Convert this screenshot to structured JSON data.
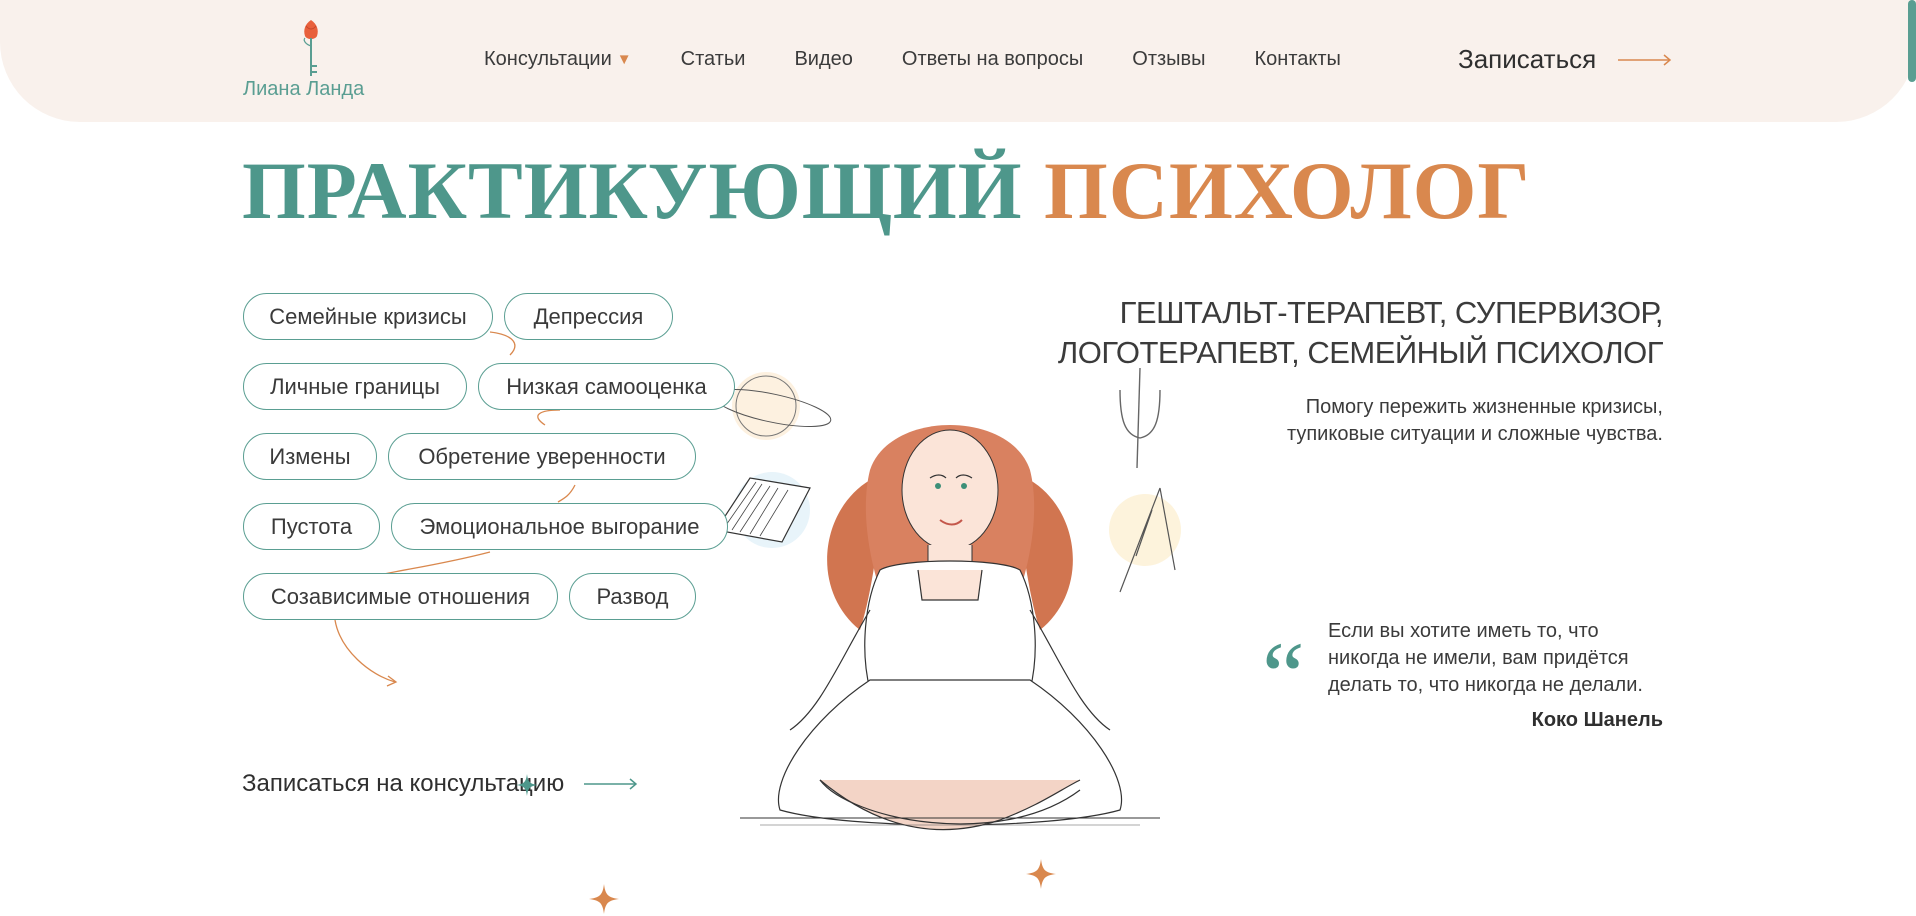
{
  "header": {
    "logo_text": "Лиана Ланда",
    "nav": [
      {
        "label": "Консультации",
        "has_dropdown": true
      },
      {
        "label": "Статьи"
      },
      {
        "label": "Видео"
      },
      {
        "label": "Ответы на вопросы"
      },
      {
        "label": "Отзывы"
      },
      {
        "label": "Контакты"
      }
    ],
    "signup_label": "Записаться"
  },
  "hero": {
    "title_part1": "ПРАКТИКУЮЩИЙ",
    "title_part2": "ПСИХОЛОГ",
    "tags": [
      "Семейные кризисы",
      "Депрессия",
      "Личные границы",
      "Низкая самооценка",
      "Измены",
      "Обретение уверенности",
      "Пустота",
      "Эмоциональное выгорание",
      "Созависимые отношения",
      "Развод"
    ],
    "cta_label": "Записаться на консультацию"
  },
  "profile": {
    "subtitle_line1": "ГЕШТАЛЬТ-ТЕРАПЕВТ, СУПЕРВИЗОР,",
    "subtitle_line2": "ЛОГОТЕРАПЕВТ, СЕМЕЙНЫЙ ПСИХОЛОГ",
    "help_line1": "Помогу пережить жизненные кризисы,",
    "help_line2": "тупиковые ситуации и сложные чувства."
  },
  "quote": {
    "mark": "“",
    "line1": "Если вы хотите иметь то, что",
    "line2": "никогда не имели, вам придётся",
    "line3": "делать то, что никогда не делали.",
    "author": "Коко Шанель"
  },
  "colors": {
    "teal": "#4e978b",
    "orange": "#d9884e",
    "header_bg": "#f9f1ec"
  }
}
